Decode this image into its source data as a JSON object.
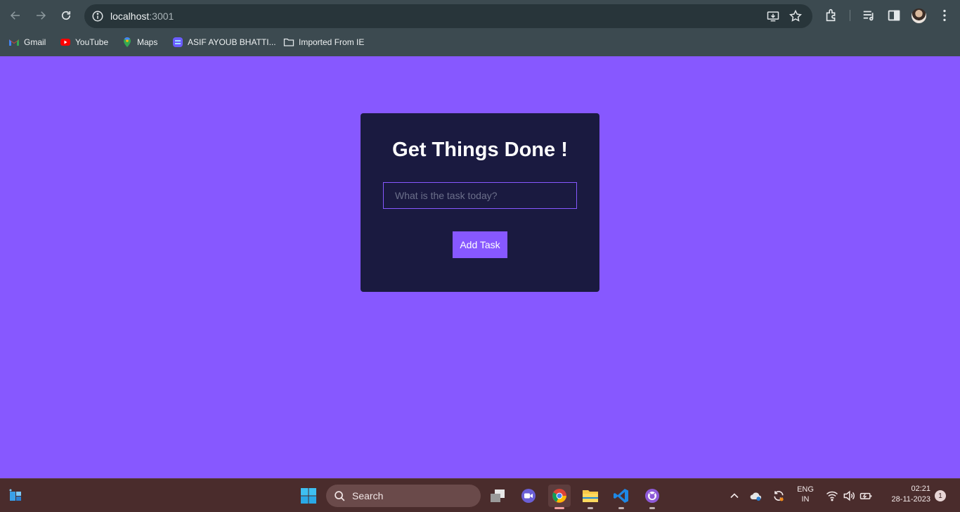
{
  "browser": {
    "url_host": "localhost",
    "url_port": ":3001",
    "bookmarks": [
      {
        "label": "Gmail",
        "icon": "gmail-icon"
      },
      {
        "label": "YouTube",
        "icon": "youtube-icon"
      },
      {
        "label": "Maps",
        "icon": "maps-icon"
      },
      {
        "label": "ASIF AYOUB BHATTI...",
        "icon": "bookmark-site-icon"
      },
      {
        "label": "Imported From IE",
        "icon": "folder-icon"
      }
    ]
  },
  "app": {
    "title": "Get Things Done !",
    "input_placeholder": "What is the task today?",
    "input_value": "",
    "add_button_label": "Add Task",
    "colors": {
      "page_background": "#8758ff",
      "card_background": "#1a1a40",
      "accent": "#8758ff"
    }
  },
  "taskbar": {
    "search_label": "Search",
    "language_top": "ENG",
    "language_bottom": "IN",
    "time": "02:21",
    "date": "28-11-2023",
    "notification_count": "1"
  }
}
